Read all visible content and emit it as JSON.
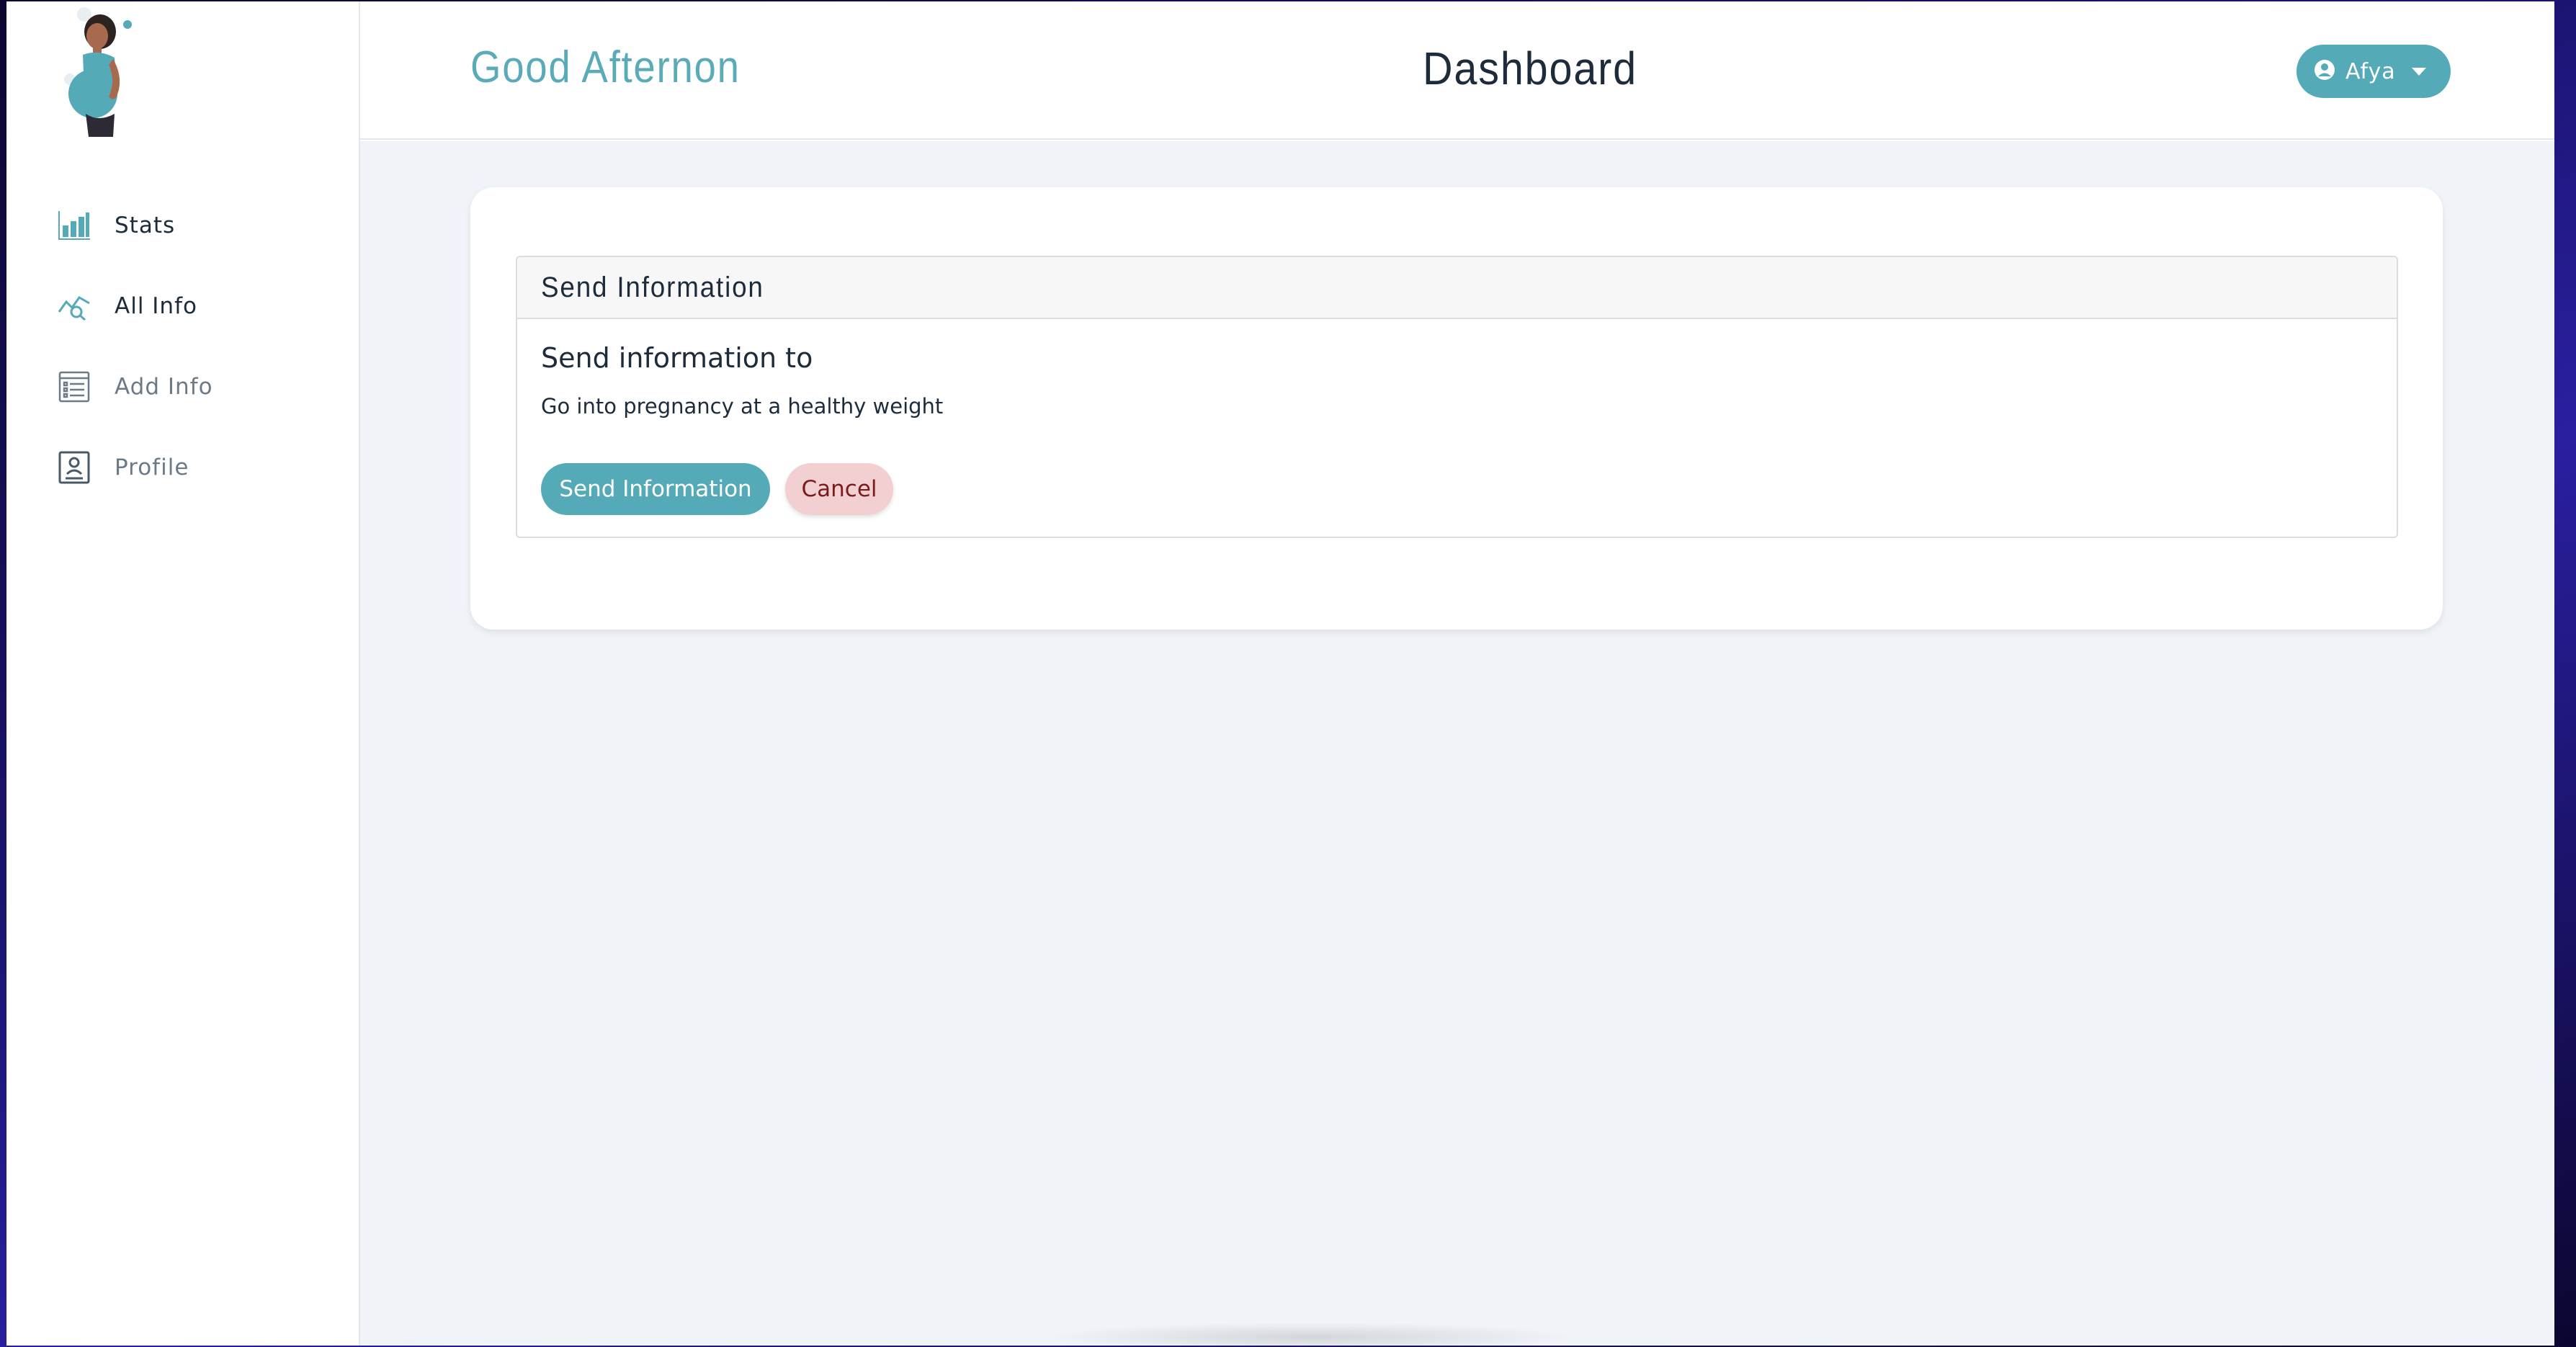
{
  "header": {
    "greeting": "Good Afternon",
    "title": "Dashboard",
    "user_menu": {
      "label": "Afya",
      "icon": "user-circle-icon"
    }
  },
  "sidebar": {
    "logo": "pregnant-woman-illustration",
    "items": [
      {
        "label": "Stats",
        "icon": "bar-chart-icon"
      },
      {
        "label": "All Info",
        "icon": "trend-search-icon"
      },
      {
        "label": "Add Info",
        "icon": "form-list-icon"
      },
      {
        "label": "Profile",
        "icon": "profile-card-icon"
      }
    ]
  },
  "panel": {
    "title": "Send Information",
    "subtitle": "Send information to",
    "text": "Go into pregnancy at a healthy weight",
    "send_label": "Send Information",
    "cancel_label": "Cancel"
  },
  "colors": {
    "accent": "#55aab8",
    "text_dark": "#1d2b3a",
    "text_muted": "#6c7a88",
    "background": "#f0f3f7",
    "cancel_bg": "#f2d0d2",
    "cancel_text": "#7a1c1c"
  }
}
